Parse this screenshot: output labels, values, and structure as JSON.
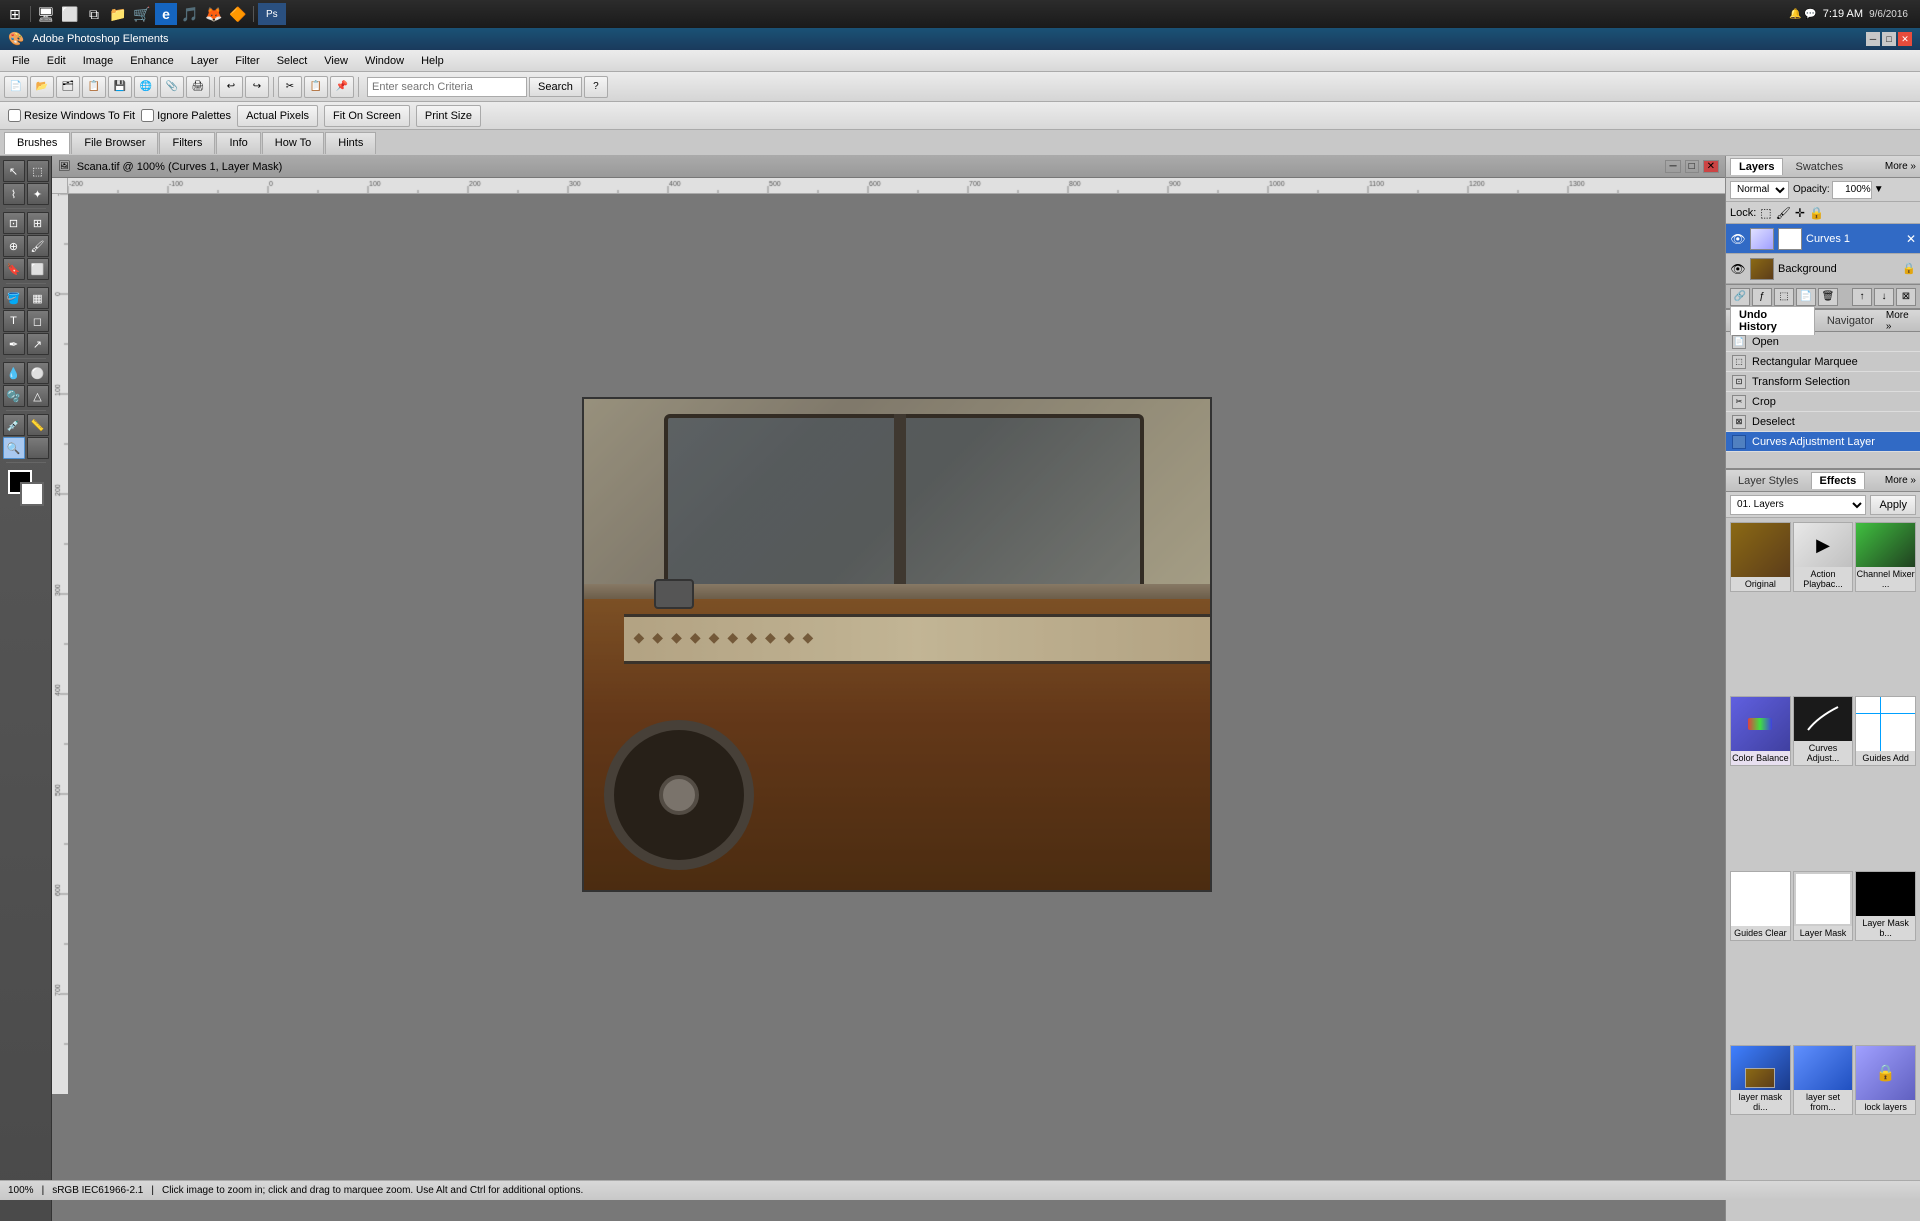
{
  "window": {
    "title": "Adobe Photoshop Elements",
    "document_title": "Scana.tif @ 100% (Curves 1, Layer Mask)"
  },
  "taskbar": {
    "time": "7:19 AM",
    "date": "9/6/2016"
  },
  "menubar": {
    "items": [
      "File",
      "Edit",
      "Image",
      "Enhance",
      "Layer",
      "Filter",
      "Select",
      "View",
      "Window",
      "Help"
    ]
  },
  "toolbar": {
    "search_placeholder": "Enter search Criteria",
    "search_button": "Search"
  },
  "shortcuts": {
    "tabs": [
      "Brushes",
      "File Browser",
      "Filters",
      "Info",
      "How To",
      "Hints"
    ]
  },
  "options_bar": {
    "resize_windows": "Resize Windows To Fit",
    "ignore_palettes": "Ignore Palettes",
    "actual_pixels": "Actual Pixels",
    "fit_on_screen": "Fit On Screen",
    "print_size": "Print Size"
  },
  "layers_panel": {
    "tab_layers": "Layers",
    "tab_swatches": "Swatches",
    "more_label": "More »",
    "blend_mode": "Normal",
    "opacity_label": "Opacity:",
    "opacity_value": "100%",
    "lock_label": "Lock:",
    "layers": [
      {
        "id": "curves1",
        "name": "Curves 1",
        "visible": true,
        "active": true,
        "has_mask": true,
        "mask_white": true
      },
      {
        "id": "background",
        "name": "Background",
        "visible": true,
        "active": false,
        "has_mask": false,
        "locked": true
      }
    ]
  },
  "history_panel": {
    "tab_undo": "Undo History",
    "tab_navigator": "Navigator",
    "more_label": "More »",
    "items": [
      {
        "id": 1,
        "name": "Open",
        "active": false
      },
      {
        "id": 2,
        "name": "Rectangular Marquee",
        "active": false
      },
      {
        "id": 3,
        "name": "Transform Selection",
        "active": false
      },
      {
        "id": 4,
        "name": "Crop",
        "active": false
      },
      {
        "id": 5,
        "name": "Deselect",
        "active": false
      },
      {
        "id": 6,
        "name": "Curves Adjustment Layer",
        "active": true
      }
    ]
  },
  "effects_panel": {
    "tab_layer_styles": "Layer Styles",
    "tab_effects": "Effects",
    "more_label": "More »",
    "category_label": "01. Layers",
    "apply_button": "Apply",
    "effects": [
      {
        "id": "original",
        "name": "Original"
      },
      {
        "id": "action_playback",
        "name": "Action Playbac..."
      },
      {
        "id": "channel_mixer",
        "name": "Channel Mixer ..."
      },
      {
        "id": "color_balance",
        "name": "Color Balance"
      },
      {
        "id": "curves_adjust",
        "name": "Curves Adjust..."
      },
      {
        "id": "guides_add",
        "name": "Guides Add"
      },
      {
        "id": "guides_clear",
        "name": "Guides Clear"
      },
      {
        "id": "layer_mask",
        "name": "Layer Mask"
      },
      {
        "id": "layer_mask_b",
        "name": "Layer Mask b..."
      },
      {
        "id": "layer_mask_d",
        "name": "layer mask di..."
      },
      {
        "id": "layer_set_from",
        "name": "layer set from..."
      },
      {
        "id": "lock_layers",
        "name": "lock layers"
      }
    ]
  },
  "status_bar": {
    "zoom": "100%",
    "profile": "sRGB IEC61966-2.1",
    "message": "Click image to zoom in; click and drag to marquee zoom. Use Alt and Ctrl for additional options."
  }
}
